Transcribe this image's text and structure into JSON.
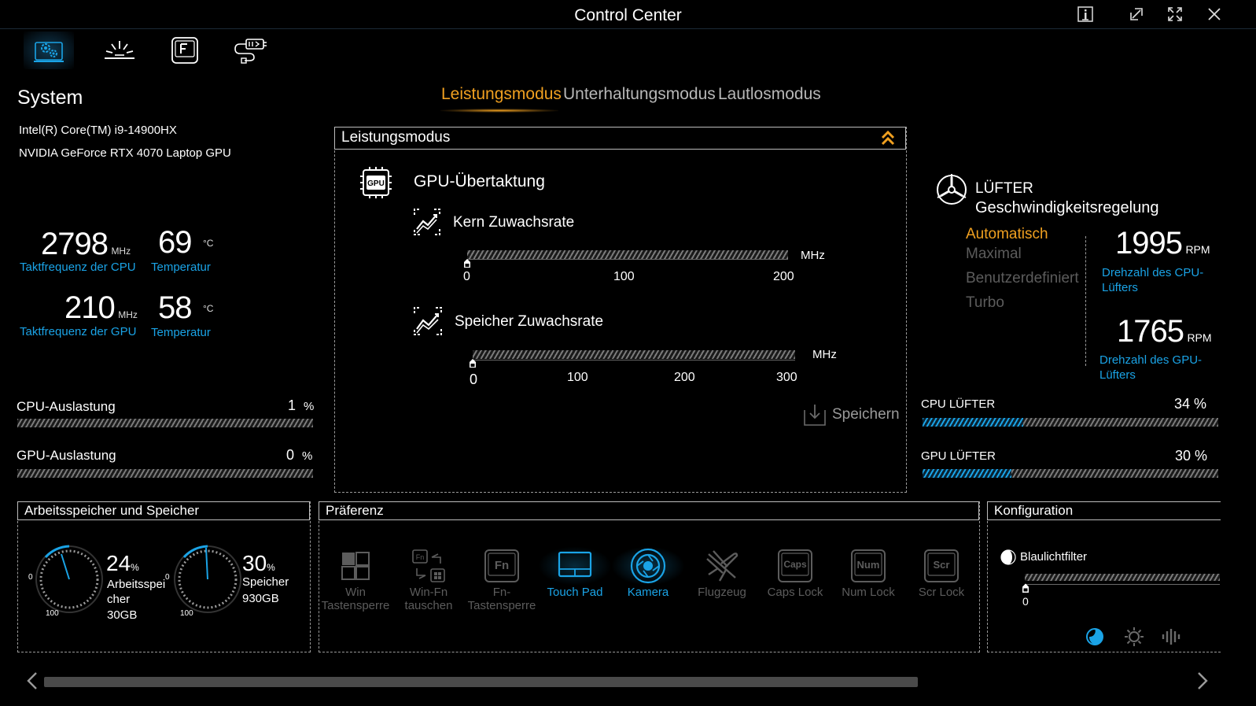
{
  "window": {
    "title": "Control Center",
    "controls": [
      "info-icon",
      "restore-icon",
      "maximize-icon",
      "close-icon"
    ]
  },
  "nav": {
    "items": [
      {
        "name": "system-settings",
        "icon": "gear-icon",
        "active": true
      },
      {
        "name": "lighting",
        "icon": "light-burst-icon",
        "active": false
      },
      {
        "name": "function-keys",
        "icon": "f-key-icon",
        "active": false
      },
      {
        "name": "usb-power",
        "icon": "usb-power-icon",
        "active": false
      }
    ]
  },
  "system": {
    "title": "System",
    "cpu_name": "Intel(R) Core(TM) i9-14900HX",
    "gpu_name": "NVIDIA GeForce RTX 4070 Laptop GPU",
    "cpu_clock": {
      "value": "2798",
      "unit": "MHz",
      "label": "Taktfrequenz der CPU"
    },
    "cpu_temp": {
      "value": "69",
      "unit": "°C",
      "label": "Temperatur"
    },
    "gpu_clock": {
      "value": "210",
      "unit": "MHz",
      "label": "Taktfrequenz der GPU"
    },
    "gpu_temp": {
      "value": "58",
      "unit": "°C",
      "label": "Temperatur"
    },
    "cpu_load": {
      "label": "CPU-Auslastung",
      "value": "1",
      "unit": "%",
      "fraction": 0.01
    },
    "gpu_load": {
      "label": "GPU-Auslastung",
      "value": "0",
      "unit": "%",
      "fraction": 0.0
    }
  },
  "modes": {
    "tabs": [
      "Leistungsmodus",
      "Unterhaltungsmodus",
      "Lautlosmodus"
    ],
    "active": "Leistungsmodus"
  },
  "performance": {
    "panel_title": "Leistungsmodus",
    "gpu_oc_title": "GPU-Übertaktung",
    "core": {
      "label": "Kern Zuwachsrate",
      "unit": "MHz",
      "ticks": [
        "0",
        "100",
        "200"
      ],
      "value": 0,
      "max": 200
    },
    "memory": {
      "label": "Speicher Zuwachsrate",
      "unit": "MHz",
      "ticks": [
        "0",
        "100",
        "200",
        "300"
      ],
      "value": 0,
      "max": 300
    },
    "save_label": "Speichern"
  },
  "fan": {
    "title_line1": "LÜFTER",
    "title_line2": "Geschwindigkeitsregelung",
    "modes": [
      "Automatisch",
      "Maximal",
      "Benutzerdefiniert",
      "Turbo"
    ],
    "active_mode": "Automatisch",
    "cpu_rpm": {
      "value": "1995",
      "unit": "RPM",
      "label": "Drehzahl des CPU-Lüfters"
    },
    "gpu_rpm": {
      "value": "1765",
      "unit": "RPM",
      "label": "Drehzahl des GPU-Lüfters"
    },
    "cpu_fan": {
      "label": "CPU LÜFTER",
      "value": "34 %",
      "fraction": 0.34
    },
    "gpu_fan": {
      "label": "GPU LÜFTER",
      "value": "30 %",
      "fraction": 0.3
    }
  },
  "memory": {
    "panel_title": "Arbeitsspeicher und Speicher",
    "ram": {
      "percent": "24",
      "pct_sign": "%",
      "label": "Arbeitsspeicher",
      "size": "30GB",
      "fraction": 0.24,
      "min": "0",
      "max": "100"
    },
    "storage": {
      "percent": "30",
      "pct_sign": "%",
      "label": "Speicher",
      "size": "930GB",
      "fraction": 0.3,
      "min": "0",
      "max": "100"
    }
  },
  "preference": {
    "panel_title": "Präferenz",
    "items": [
      {
        "label": "Win Tastensperre",
        "icon": "windows-grid-icon",
        "on": false
      },
      {
        "label": "Win-Fn tauschen",
        "icon": "swap-keys-icon",
        "on": false
      },
      {
        "label": "Fn-Tastensperre",
        "icon": "fn-key-icon",
        "on": false
      },
      {
        "label": "Touch Pad",
        "icon": "touchpad-icon",
        "on": true
      },
      {
        "label": "Kamera",
        "icon": "camera-icon",
        "on": true
      },
      {
        "label": "Flugzeug",
        "icon": "airplane-icon",
        "on": false
      },
      {
        "label": "Caps Lock",
        "icon": "caps-key-icon",
        "on": false
      },
      {
        "label": "Num Lock",
        "icon": "num-key-icon",
        "on": false
      },
      {
        "label": "Scr Lock",
        "icon": "scr-key-icon",
        "on": false
      }
    ],
    "key_texts": {
      "fn": "Fn",
      "caps": "Caps",
      "num": "Num",
      "scr": "Scr",
      "fn_small": "Fn"
    }
  },
  "config": {
    "panel_title": "Konfiguration",
    "bluelight_label": "Blaulichtfilter",
    "bluelight_value": "0",
    "bluelight_fraction": 0.0,
    "modes": [
      "moon-icon",
      "sun-icon",
      "equalizer-icon"
    ]
  },
  "colors": {
    "accent": "#f0a020",
    "blue": "#1aa3e6",
    "muted": "#5c5c5c"
  }
}
